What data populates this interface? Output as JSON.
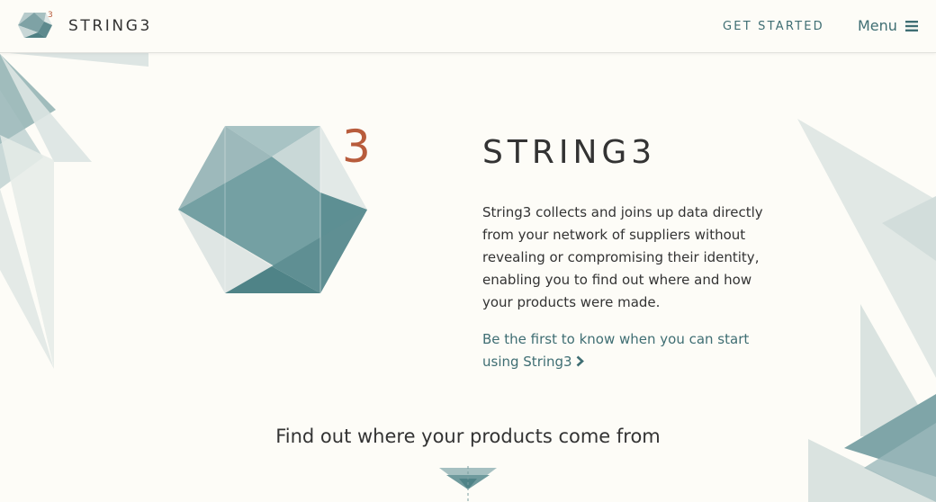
{
  "header": {
    "brand": "STRING3",
    "logo_superscript": "3",
    "get_started_label": "GET STARTED",
    "menu_label": "Menu"
  },
  "hero": {
    "logo_superscript": "3",
    "title": "STRING3",
    "description": "String3 collects and joins up data directly from your network of suppliers without revealing or compromising their identity, enabling you to find out where and how your products were made.",
    "cta_label": "Be the first to know when you can start using String3"
  },
  "section": {
    "heading": "Find out where your products come from"
  },
  "colors": {
    "accent": "#3f6e73",
    "superscript": "#b85c3c",
    "background": "#fdfcf7",
    "text": "#333333"
  },
  "icons": {
    "logo": "hexagon-cube-icon",
    "menu": "hamburger-icon",
    "cta": "chevron-right-icon",
    "scroll": "down-triangle-icon"
  }
}
